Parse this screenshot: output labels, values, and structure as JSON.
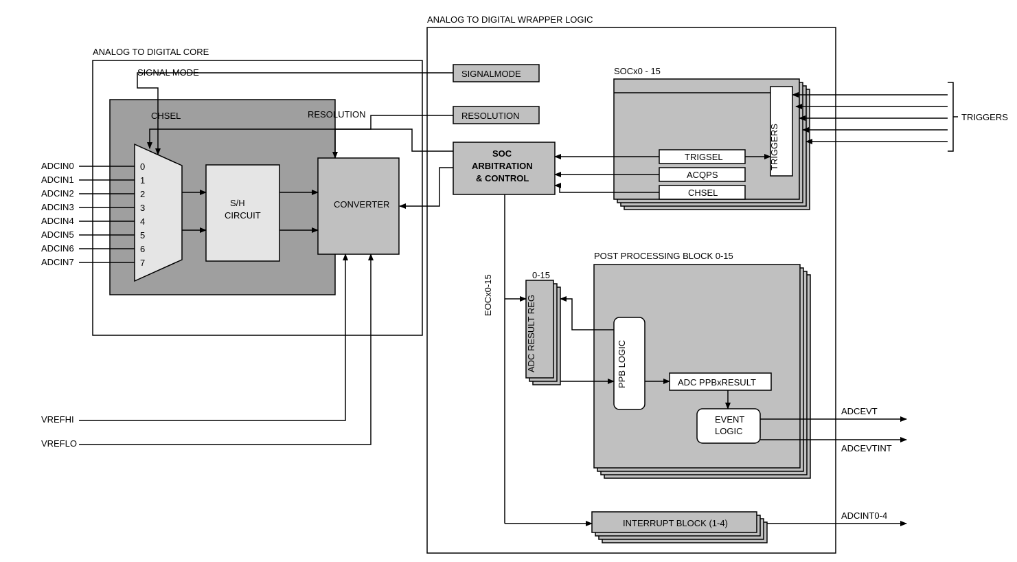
{
  "titles": {
    "wrapper": "ANALOG TO DIGITAL WRAPPER LOGIC",
    "core": "ANALOG TO DIGITAL CORE"
  },
  "core": {
    "signal_mode": "SIGNAL MODE",
    "chsel": "CHSEL",
    "resolution": "RESOLUTION",
    "sh": "S/H\nCIRCUIT",
    "converter": "CONVERTER",
    "mux_nums": [
      "0",
      "1",
      "2",
      "3",
      "4",
      "5",
      "6",
      "7"
    ]
  },
  "inputs": {
    "adcin": [
      "ADCIN0",
      "ADCIN1",
      "ADCIN2",
      "ADCIN3",
      "ADCIN4",
      "ADCIN5",
      "ADCIN6",
      "ADCIN7"
    ],
    "vrefhi": "VREFHI",
    "vreflo": "VREFLO"
  },
  "wrapper": {
    "signalmode": "SIGNALMODE",
    "resolution": "RESOLUTION",
    "soc_arb": "SOC\nARBITRATION\n& CONTROL",
    "socx": "SOCx0 - 15",
    "trigsel": "TRIGSEL",
    "acqps": "ACQPS",
    "chsel": "CHSEL",
    "triggers_v": "TRIGGERS",
    "triggers": "TRIGGERS",
    "eoc": "EOCx0-15",
    "result_reg_title": "0-15",
    "result_reg": "ADC RESULT REG",
    "ppb_title": "POST PROCESSING BLOCK 0-15",
    "ppb_logic": "PPB LOGIC",
    "ppb_result": "ADC PPBxRESULT",
    "event_logic": "EVENT\nLOGIC",
    "interrupt": "INTERRUPT BLOCK (1-4)"
  },
  "outputs": {
    "adcevt": "ADCEVT",
    "adcevtint": "ADCEVTINT",
    "adcint": "ADCINT0-4"
  }
}
